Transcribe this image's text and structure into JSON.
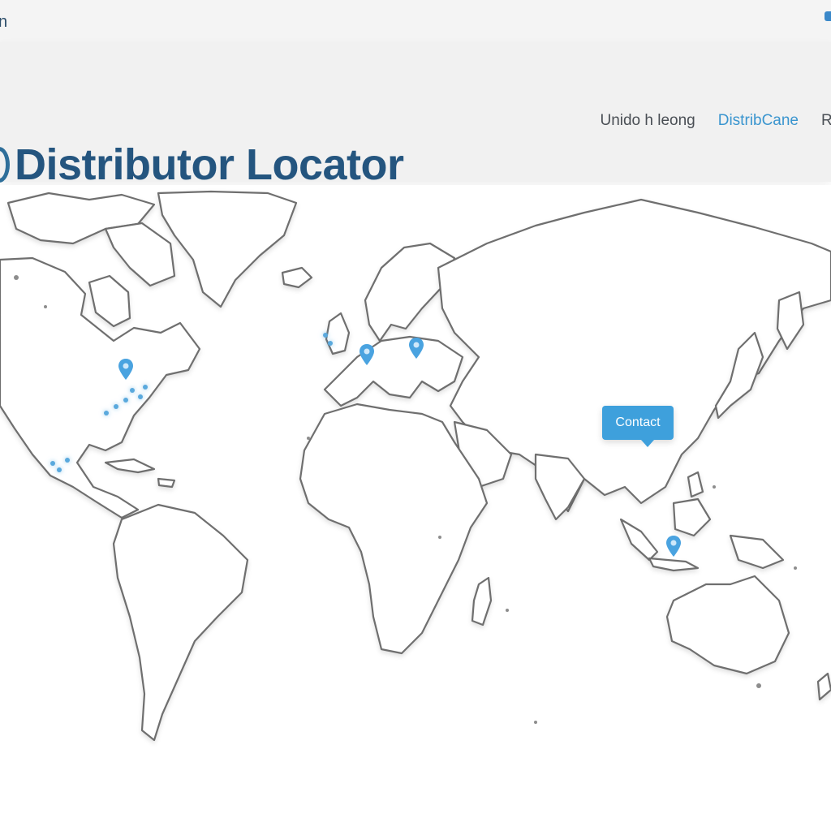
{
  "header": {
    "top_left_text": "n",
    "title": "Distributor Locator",
    "nav": [
      {
        "label": "Unido h leong",
        "active": false
      },
      {
        "label": "DistribCane",
        "active": true
      },
      {
        "label": "R",
        "active": false
      }
    ]
  },
  "map": {
    "tooltip": "Contact",
    "pins": [
      "north-america",
      "western-europe",
      "central-europe",
      "southeast-asia"
    ]
  },
  "colors": {
    "accent": "#3ea0dc",
    "title": "#24557f",
    "header_bg": "#f1f1f1"
  }
}
